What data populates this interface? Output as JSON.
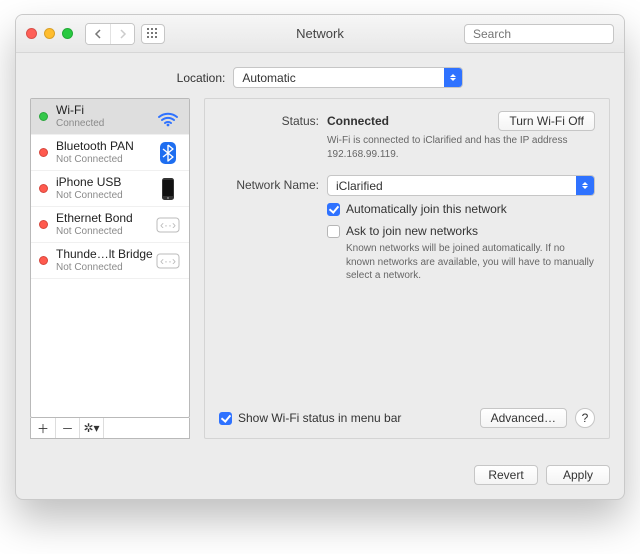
{
  "window": {
    "title": "Network"
  },
  "toolbar": {
    "search_placeholder": "Search"
  },
  "location": {
    "label": "Location:",
    "value": "Automatic"
  },
  "sidebar": {
    "items": [
      {
        "name": "Wi-Fi",
        "status": "Connected",
        "connected": true,
        "icon": "wifi"
      },
      {
        "name": "Bluetooth PAN",
        "status": "Not Connected",
        "connected": false,
        "icon": "bluetooth"
      },
      {
        "name": "iPhone USB",
        "status": "Not Connected",
        "connected": false,
        "icon": "phone"
      },
      {
        "name": "Ethernet Bond",
        "status": "Not Connected",
        "connected": false,
        "icon": "ethernet"
      },
      {
        "name": "Thunde…lt Bridge",
        "status": "Not Connected",
        "connected": false,
        "icon": "ethernet"
      }
    ]
  },
  "main": {
    "status_label": "Status:",
    "status_value": "Connected",
    "toggle_label": "Turn Wi-Fi Off",
    "status_desc": "Wi-Fi is connected to iClarified and has the IP address 192.168.99.119.",
    "network_label": "Network Name:",
    "network_value": "iClarified",
    "auto_join": {
      "checked": true,
      "label": "Automatically join this network"
    },
    "ask_join": {
      "checked": false,
      "label": "Ask to join new networks",
      "desc": "Known networks will be joined automatically. If no known networks are available, you will have to manually select a network."
    },
    "show_menubar": {
      "checked": true,
      "label": "Show Wi-Fi status in menu bar"
    },
    "advanced_label": "Advanced…",
    "help_label": "?"
  },
  "footer": {
    "revert": "Revert",
    "apply": "Apply"
  }
}
